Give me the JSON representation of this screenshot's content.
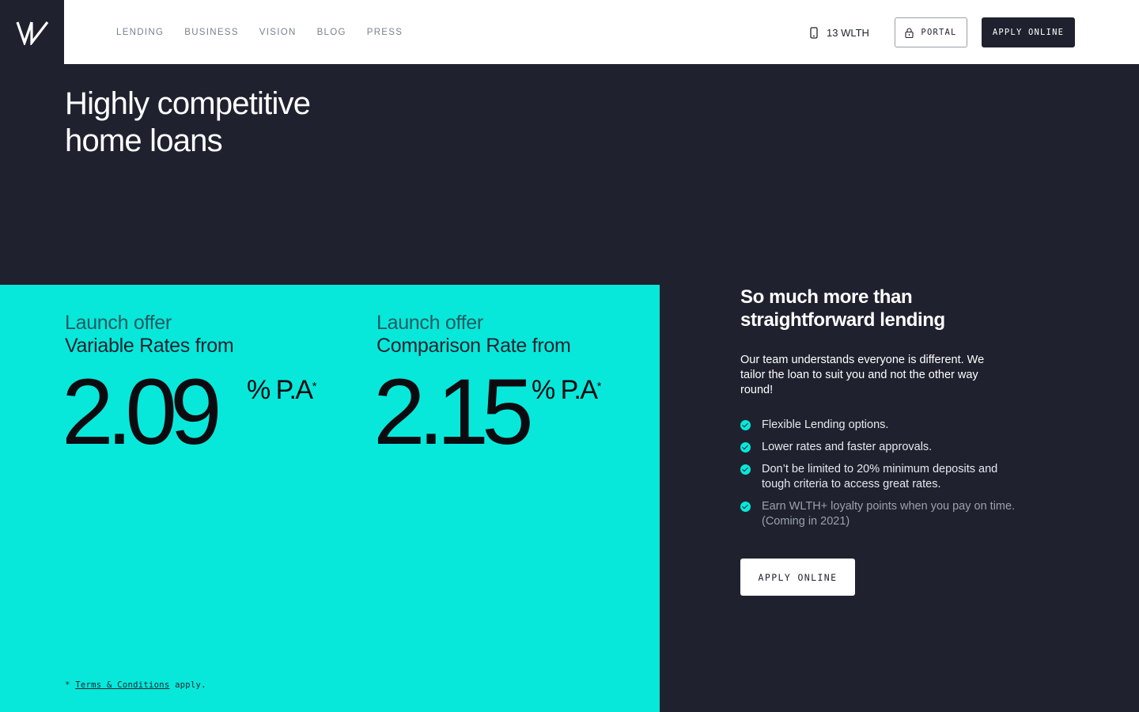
{
  "header": {
    "logo_icon": "wealth-w-logo",
    "nav": [
      {
        "label": "LENDING"
      },
      {
        "label": "BUSINESS"
      },
      {
        "label": "VISION"
      },
      {
        "label": "BLOG"
      },
      {
        "label": "PRESS"
      }
    ],
    "phone": {
      "icon": "mobile-phone-icon",
      "label": "13 WLTH"
    },
    "portal_button": {
      "icon": "lock-icon",
      "label": "PORTAL"
    },
    "apply_button": {
      "label": "APPLY ONLINE"
    }
  },
  "hero": {
    "title_line1": "Highly competitive",
    "title_line2": "home loans"
  },
  "rates": {
    "background_color": "#07e8da",
    "items": [
      {
        "label": "Launch offer",
        "sublabel": "Variable Rates from",
        "value": "2.09",
        "unit": "% P.A",
        "asterisk": "*"
      },
      {
        "label": "Launch offer",
        "sublabel": "Comparison Rate from",
        "value": "2.15",
        "unit": "% P.A",
        "asterisk": "*"
      }
    ],
    "terms": {
      "prefix": "*",
      "link": "Terms & Conditions",
      "suffix": "apply."
    }
  },
  "info": {
    "title_line1": "So much more than",
    "title_line2": "straightforward lending",
    "description": "Our team understands everyone is different. We tailor the loan to suit you and not the other way round!",
    "features": [
      {
        "text": "Flexible Lending options."
      },
      {
        "text": "Lower rates and faster approvals."
      },
      {
        "text": "Don’t be limited to 20% minimum deposits and tough criteria to access great rates."
      },
      {
        "text": "Earn WLTH+ loyalty points when you pay on time. (Coming in 2021)"
      }
    ],
    "apply_button": {
      "label": "APPLY ONLINE"
    }
  }
}
